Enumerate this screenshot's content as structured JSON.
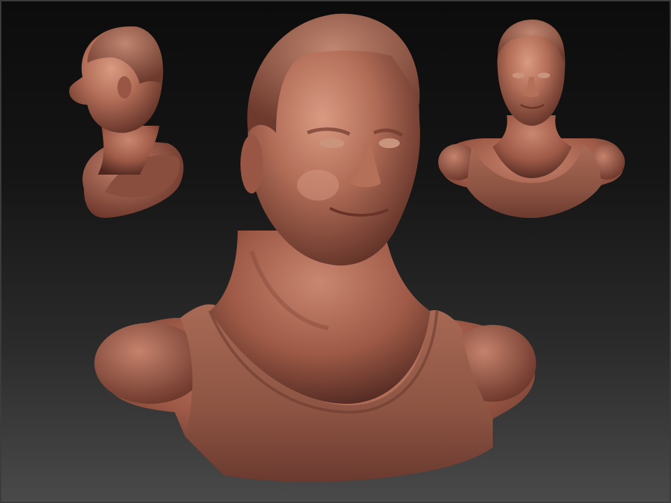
{
  "scene": {
    "colors": {
      "background_top": "#0c0c0c",
      "background_bottom": "#4a4a4a",
      "clay_light": "#c98a74",
      "clay_mid": "#a5614d",
      "clay_dark": "#5e2f25"
    },
    "views": [
      "side-view-bust",
      "front-view-bust-large",
      "front-view-bust-small"
    ]
  }
}
